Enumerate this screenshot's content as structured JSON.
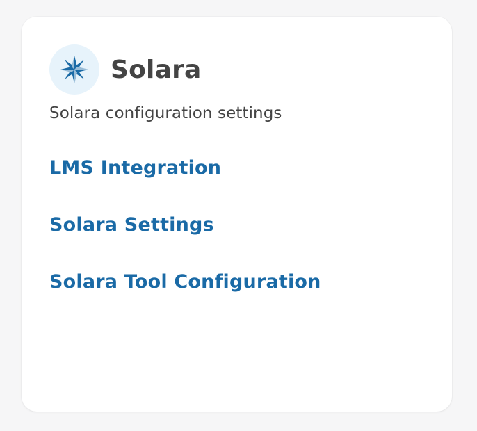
{
  "card": {
    "title": "Solara",
    "subtitle": "Solara configuration settings",
    "icon": "compass-star-icon",
    "links": [
      {
        "label": "LMS Integration"
      },
      {
        "label": "Solara Settings"
      },
      {
        "label": "Solara Tool Configuration"
      }
    ]
  },
  "colors": {
    "accent": "#1a6aa6",
    "icon_bg": "#e7f3fb",
    "text": "#444444",
    "page_bg": "#f6f6f7"
  }
}
